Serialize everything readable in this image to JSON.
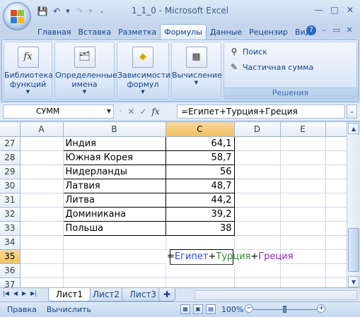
{
  "window": {
    "title": "1_1_0  -  Microsoft Excel"
  },
  "ribbon": {
    "tabs": [
      "Главная",
      "Вставка",
      "Разметка",
      "Формулы",
      "Данные",
      "Рецензир",
      "Вид"
    ],
    "active_tab": "Формулы",
    "buttons": {
      "library": "Библиотека функций",
      "names": "Определенные имена",
      "deps": "Зависимости формул",
      "calc": "Вычисление"
    },
    "solutions": {
      "search": "Поиск",
      "partial_sum": "Частичная сумма",
      "group_label": "Решения"
    }
  },
  "formula_bar": {
    "name_box": "СУММ",
    "formula": "=Египет+Турция+Греция"
  },
  "grid": {
    "columns": [
      "A",
      "B",
      "C",
      "D",
      "E"
    ],
    "selected_column": "C",
    "selected_row": "35",
    "rows": [
      {
        "row": "27",
        "country": "Индия",
        "value": "64,1"
      },
      {
        "row": "28",
        "country": "Южная Корея",
        "value": "58,7"
      },
      {
        "row": "29",
        "country": "Нидерланды",
        "value": "56"
      },
      {
        "row": "30",
        "country": "Латвия",
        "value": "48,7"
      },
      {
        "row": "31",
        "country": "Литва",
        "value": "44,2"
      },
      {
        "row": "32",
        "country": "Доминикана",
        "value": "39,2"
      },
      {
        "row": "33",
        "country": "Польша",
        "value": "38"
      }
    ],
    "empty_rows": [
      "34",
      "35",
      "36",
      "37"
    ],
    "editing_cell": {
      "eq": "=",
      "ref1": "Египет",
      "op1": "+",
      "ref2": "Турция",
      "op2": "+",
      "ref3": "Греция"
    }
  },
  "sheets": [
    "Лист1",
    "Лист2",
    "Лист3"
  ],
  "active_sheet": "Лист1",
  "status": {
    "mode": "Правка",
    "calc": "Вычислить",
    "zoom": "100%"
  },
  "colors": {
    "ref1": "#2b49d8",
    "ref2": "#2e8d2e",
    "ref3": "#8a2bbd",
    "selected_header": "#f1c15f"
  }
}
